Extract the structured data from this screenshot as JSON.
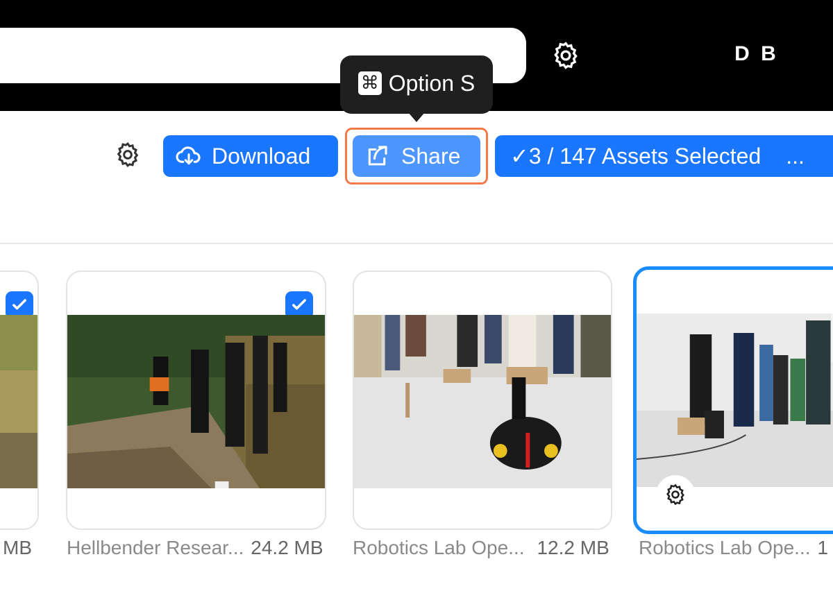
{
  "header": {
    "avatar_initials": "D B",
    "settings_icon": "gear-icon"
  },
  "tooltip": {
    "key_symbol": "⌘",
    "text": "Option S"
  },
  "toolbar": {
    "download_label": "Download",
    "share_label": "Share",
    "selected_label": "✓3 / 147  Assets Selected",
    "more_label": "..."
  },
  "assets": [
    {
      "name": "",
      "size": "MB",
      "selected": true
    },
    {
      "name": "Hellbender Resear...",
      "size": "24.2 MB",
      "selected": true
    },
    {
      "name": "Robotics Lab Ope...",
      "size": "12.2 MB",
      "selected": false
    },
    {
      "name": "Robotics Lab Ope...",
      "size": "1",
      "selected": false,
      "focused": true
    }
  ],
  "colors": {
    "accent": "#1a75ff",
    "share_hover": "#4d96ff",
    "highlight": "#f07a4a",
    "focus_border": "#1a8cff"
  }
}
